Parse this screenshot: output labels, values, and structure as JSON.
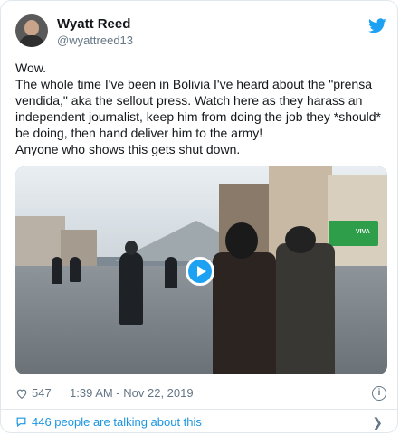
{
  "author": {
    "name": "Wyatt Reed",
    "handle": "@wyattreed13"
  },
  "tweet": {
    "line1": "Wow.",
    "line2": "The whole time I've been in Bolivia I've heard about the \"prensa vendida,\" aka the sellout press. Watch here as they harass an independent journalist, keep him from doing the job they *should* be doing, then hand deliver him to the army!",
    "line3": "Anyone who shows this gets shut down."
  },
  "media": {
    "type": "video",
    "play_icon": "play-icon",
    "sign_text": "VIVA"
  },
  "meta": {
    "likes": "547",
    "timestamp": "1:39 AM - Nov 22, 2019"
  },
  "footer": {
    "talking": "446 people are talking about this"
  },
  "colors": {
    "accent": "#1da1f2",
    "link": "#1b95e0",
    "muted": "#657786"
  }
}
